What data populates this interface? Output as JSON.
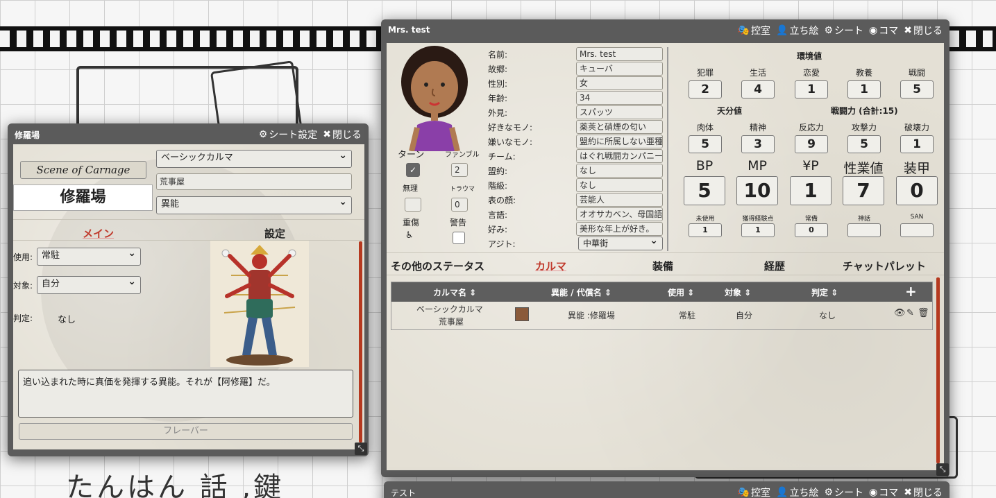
{
  "left_window": {
    "title": "修羅場",
    "controls": {
      "sheet_settings": "シート設定",
      "close": "閉じる"
    },
    "scene_button": "Scene of Carnage",
    "name": "修羅場",
    "select_karma": "ベーシックカルマ",
    "field_arasogoto": "荒事屋",
    "select_type": "異能",
    "tabs": {
      "main": "メイン",
      "settings": "設定"
    },
    "use_label": "使用:",
    "use_value": "常駐",
    "target_label": "対象:",
    "target_value": "自分",
    "judge_label": "判定:",
    "judge_value": "なし",
    "description": "追い込まれた時に真価を発揮する異能。それが【阿修羅】だ。",
    "flavor_button": "フレーバー"
  },
  "right_window": {
    "title": "Mrs. test",
    "controls": {
      "room": "控室",
      "standing": "立ち絵",
      "sheet": "シート",
      "piece": "コマ",
      "close": "閉じる"
    },
    "profile": [
      {
        "label": "名前:",
        "value": "Mrs. test"
      },
      {
        "label": "故郷:",
        "value": "キューバ"
      },
      {
        "label": "性別:",
        "value": "女"
      },
      {
        "label": "年齢:",
        "value": "34"
      },
      {
        "label": "外見:",
        "value": "スパッツ"
      },
      {
        "label": "好きなモノ:",
        "value": "薬莢と硝煙の匂い"
      },
      {
        "label": "嫌いなモノ:",
        "value": "盟約に所属しない亜種"
      },
      {
        "label": "チーム:",
        "value": "はぐれ戦闘カンパニー"
      },
      {
        "label": "盟約:",
        "value": "なし"
      },
      {
        "label": "階級:",
        "value": "なし"
      },
      {
        "label": "表の顔:",
        "value": "芸能人"
      },
      {
        "label": "言語:",
        "value": "オオサカベン、母国語"
      },
      {
        "label": "好み:",
        "value": "美形な年上が好き。"
      },
      {
        "label": "アジト:",
        "value": "中華街"
      }
    ],
    "left_status": {
      "turn": "ターン",
      "fumble": "ファンブル",
      "fumble_value": "2",
      "muri": "無理",
      "trauma": "トラウマ",
      "trauma_value": "0",
      "heavy_wound": "重傷",
      "warning": "警告"
    },
    "env_header": "環境値",
    "env": [
      {
        "label": "犯罪",
        "value": "2"
      },
      {
        "label": "生活",
        "value": "4"
      },
      {
        "label": "恋愛",
        "value": "1"
      },
      {
        "label": "教養",
        "value": "1"
      },
      {
        "label": "戦闘",
        "value": "5"
      }
    ],
    "tenbun_header": "天分値",
    "combat_header": "戦闘力 (合計:15)",
    "ability": [
      {
        "label": "肉体",
        "value": "5"
      },
      {
        "label": "精神",
        "value": "3"
      },
      {
        "label": "反応力",
        "value": "9"
      },
      {
        "label": "攻撃力",
        "value": "5"
      },
      {
        "label": "破壊力",
        "value": "1"
      }
    ],
    "big": [
      {
        "label": "BP",
        "value": "5"
      },
      {
        "label": "MP",
        "value": "10"
      },
      {
        "label": "¥P",
        "value": "1"
      },
      {
        "label": "性業値",
        "value": "7"
      },
      {
        "label": "装甲",
        "value": "0"
      }
    ],
    "small": [
      {
        "label": "未使用",
        "value": "1"
      },
      {
        "label": "獲得経験点",
        "value": "1"
      },
      {
        "label": "常備",
        "value": "0"
      },
      {
        "label": "神話",
        "value": ""
      },
      {
        "label": "SAN",
        "value": ""
      }
    ],
    "tabs": [
      "その他のステータス",
      "カルマ",
      "装備",
      "経歴",
      "チャットパレット"
    ],
    "table": {
      "headers": [
        "カルマ名",
        "異能 / 代償名",
        "使用",
        "対象",
        "判定"
      ],
      "add": "+",
      "rows": [
        {
          "name1": "ベーシックカルマ",
          "name2": "荒事屋",
          "ability": "異能 :修羅場",
          "use": "常駐",
          "target": "自分",
          "judge": "なし"
        }
      ]
    }
  },
  "bottom_window": {
    "title": "テスト",
    "controls": {
      "room": "控室",
      "standing": "立ち絵",
      "sheet": "シート",
      "piece": "コマ",
      "close": "閉じる"
    }
  },
  "background": {
    "text": "たんはん 話 ,鍵"
  },
  "colors": {
    "accent_red": "#c0392b",
    "titlebar": "#5b5b5b",
    "paper": "#e4e0d5",
    "scrollbar": "#b5391f"
  }
}
